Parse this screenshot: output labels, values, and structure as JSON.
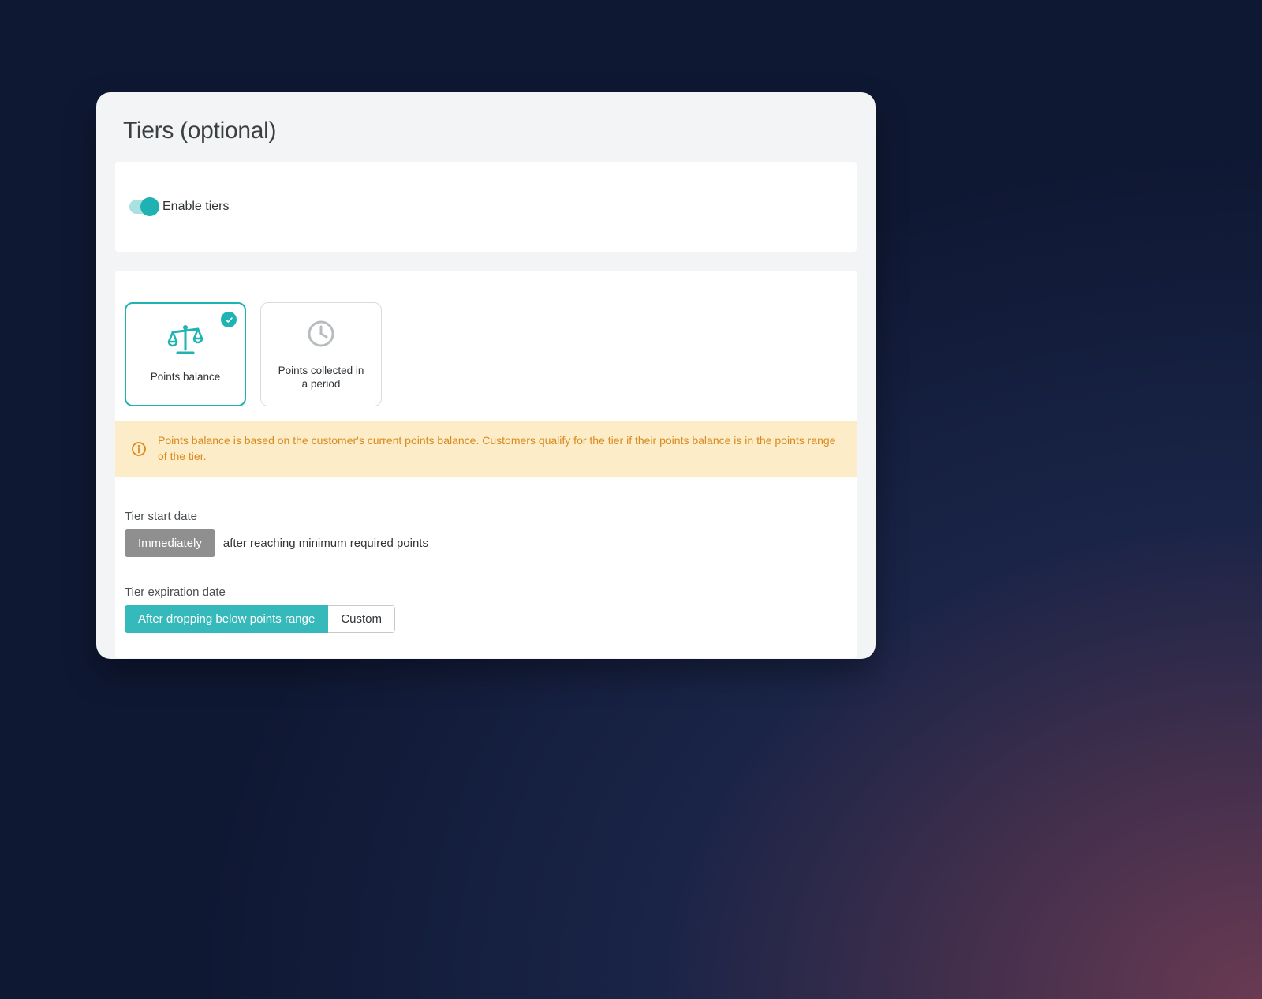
{
  "title": "Tiers (optional)",
  "enable_toggle": {
    "label": "Enable tiers",
    "on": true
  },
  "options": {
    "points_balance": {
      "label": "Points balance",
      "selected": true
    },
    "points_period": {
      "label": "Points collected in a period",
      "selected": false
    }
  },
  "info_message": "Points balance is based on the customer's current points balance. Customers qualify for the tier if their points balance is in the points range of the tier.",
  "tier_start": {
    "label": "Tier start date",
    "button": "Immediately",
    "suffix": "after reaching minimum required points"
  },
  "tier_expiration": {
    "label": "Tier expiration date",
    "option_a": "After dropping below points range",
    "option_b": "Custom"
  },
  "colors": {
    "accent": "#1fb3b3",
    "banner_bg": "#fdecc8",
    "banner_text": "#d88a1e"
  }
}
